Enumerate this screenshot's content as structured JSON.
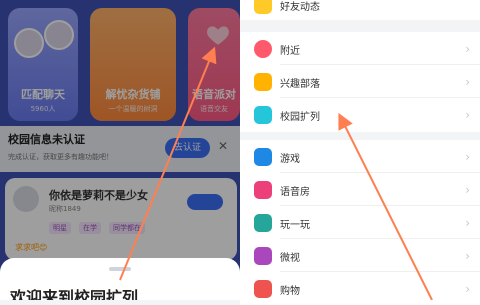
{
  "left_panel": {
    "cards": [
      {
        "title": "匹配聊天",
        "subtitle": "5960人"
      },
      {
        "title": "解忧杂货铺",
        "subtitle": "一个温暖的树洞"
      },
      {
        "title": "语音派对",
        "subtitle": "语音交友"
      }
    ],
    "banner": {
      "title": "校园信息未认证",
      "subtitle": "完成认证，获取更多有趣功能吧！",
      "button": "去认证",
      "close": "✕"
    },
    "post": {
      "name": "你依是萝莉不是少女",
      "meta": "昵称1849",
      "tags": [
        "明星",
        "在学",
        "同学都在"
      ],
      "text": "求求吧😊"
    },
    "sheet": {
      "title": "欢迎来到校园扩列"
    }
  },
  "right_panel": {
    "top_item": {
      "label": "好友动态"
    },
    "items_group1": [
      {
        "label": "附近",
        "icon": "location-icon",
        "color": "#ff5a6b"
      },
      {
        "label": "兴趣部落",
        "icon": "tribe-icon",
        "color": "#ffb300"
      },
      {
        "label": "校园扩列",
        "icon": "campus-icon",
        "color": "#26c6da"
      }
    ],
    "items_group2": [
      {
        "label": "游戏",
        "icon": "game-icon",
        "color": "#1e88e5"
      },
      {
        "label": "语音房",
        "icon": "voice-room-icon",
        "color": "#ec407a"
      },
      {
        "label": "玩一玩",
        "icon": "play-icon",
        "color": "#26a69a"
      },
      {
        "label": "微视",
        "icon": "video-icon",
        "color": "#ab47bc"
      },
      {
        "label": "购物",
        "icon": "shopping-icon",
        "color": "#ef5350"
      }
    ]
  },
  "colors": {
    "accent": "#3b6ff5",
    "arrow": "#ff7f50"
  }
}
